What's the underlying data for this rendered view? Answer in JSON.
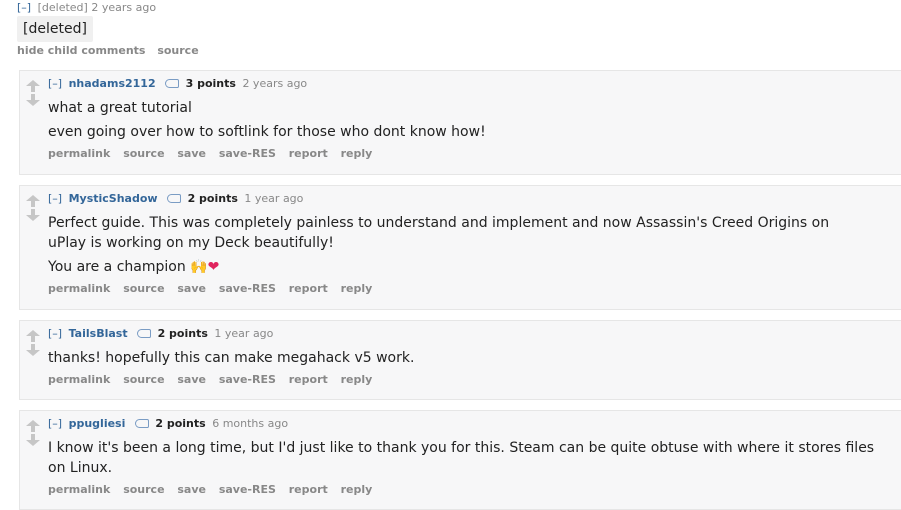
{
  "parent": {
    "expand": "[–]",
    "author": "[deleted]",
    "time": "2 years ago",
    "body": "[deleted]",
    "buttons": [
      "hide child comments",
      "source"
    ]
  },
  "buttons": [
    "permalink",
    "source",
    "save",
    "save-RES",
    "report",
    "reply"
  ],
  "comments": [
    {
      "expand": "[–]",
      "author": "nhadams2112",
      "score": "3 points",
      "time": "2 years ago",
      "paragraphs": [
        "what a great tutorial",
        "even going over how to softlink for those who dont know how!"
      ]
    },
    {
      "expand": "[–]",
      "author": "MysticShadow",
      "score": "2 points",
      "time": "1 year ago",
      "paragraphs": [
        "Perfect guide. This was completely painless to understand and implement and now Assassin's Creed Origins on uPlay is working on my Deck beautifully!"
      ],
      "champion_text": "You are a champion ",
      "emoji_hands": "🙌",
      "emoji_heart": "❤"
    },
    {
      "expand": "[–]",
      "author": "TailsBlast",
      "score": "2 points",
      "time": "1 year ago",
      "paragraphs": [
        "thanks! hopefully this can make megahack v5 work."
      ]
    },
    {
      "expand": "[–]",
      "author": "ppugliesi",
      "score": "2 points",
      "time": "6 months ago",
      "paragraphs": [
        "I know it's been a long time, but I'd just like to thank you for this. Steam can be quite obtuse with where it stores files on Linux."
      ]
    }
  ]
}
